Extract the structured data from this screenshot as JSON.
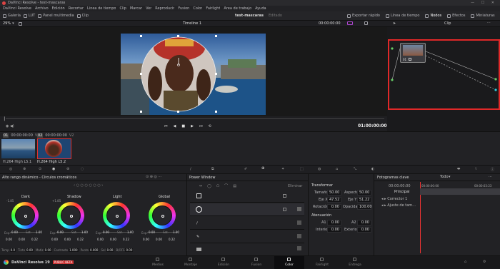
{
  "app": {
    "title": "DaVinci Resolve - test-mascaras",
    "menu": [
      "DaVinci Resolve",
      "Archivo",
      "Edición",
      "Recortar",
      "Línea de tiempo",
      "Clip",
      "Marcar",
      "Ver",
      "Reproducir",
      "Fusion",
      "Color",
      "Fairlight",
      "Área de trabajo",
      "Ayuda"
    ]
  },
  "toolbar": {
    "left": [
      "Galería",
      "LUT",
      "Panel multimedia",
      "Clip"
    ],
    "project": "test-mascaras",
    "edited": "Editado",
    "right": [
      "Exportar rápido",
      "Línea de tiempo",
      "Nodos",
      "Efectos",
      "Miniaturas"
    ]
  },
  "viewer": {
    "zoom": "29%",
    "timeline": "Timeline 1",
    "tc_in": "00:00:00:00",
    "tc_out": "01:00:00:00",
    "clip_label": "Clip"
  },
  "clips": [
    {
      "num": "01",
      "tc": "00:00:00:00",
      "track": "V1",
      "codec": "H.264 High L5.1"
    },
    {
      "num": "02",
      "tc": "00:00:00:00",
      "track": "V2",
      "codec": "H.264 High L5.2"
    }
  ],
  "node": {
    "id": "01"
  },
  "color_panel": {
    "title": "Alto rango dinámico - Círculos cromáticos",
    "wheels": [
      {
        "name": "Dark",
        "val": "-1.85",
        "exp": "0.00",
        "sat": "1.00",
        "x": "0.00",
        "y": "0.00",
        "z": "0.22"
      },
      {
        "name": "Shadow",
        "val": "+1.85",
        "exp": "0.00",
        "sat": "1.00",
        "x": "0.00",
        "y": "0.00",
        "z": "0.22"
      },
      {
        "name": "Light",
        "val": "",
        "exp": "0.00",
        "sat": "1.00",
        "x": "0.00",
        "y": "0.00",
        "z": "0.22"
      },
      {
        "name": "Global",
        "val": "",
        "exp": "0.00",
        "sat": "1.00",
        "x": "0.00",
        "y": "0.00",
        "z": "0.22"
      }
    ],
    "footer": [
      {
        "k": "Temp",
        "v": "0.0"
      },
      {
        "k": "Tinte",
        "v": "0.00"
      },
      {
        "k": "Matiz",
        "v": "0.00"
      },
      {
        "k": "Contraste",
        "v": "1.000"
      },
      {
        "k": "Punto",
        "v": "0.000"
      },
      {
        "k": "Sal",
        "v": "0.00"
      },
      {
        "k": "B/OFS",
        "v": "0.00"
      }
    ],
    "labels": {
      "exp": "Exp.",
      "sat": "Sat."
    }
  },
  "power_window": {
    "title": "Power Window",
    "delete": "Eliminar"
  },
  "transform": {
    "title": "Transformar",
    "size_label": "Tamaño",
    "size": "50.00",
    "aspect_label": "Aspecto",
    "aspect": "50.00",
    "pan_label": "Eje X",
    "pan": "47.52",
    "tilt_label": "Eje Y",
    "tilt": "51.22",
    "rot_label": "Rotación",
    "rot": "0.00",
    "opacity_label": "Opacidad",
    "opacity": "100.00",
    "soft_title": "Atenuación",
    "soft": [
      {
        "k": "A1",
        "v": "0.00"
      },
      {
        "k": "A2",
        "v": "0.00"
      },
      {
        "k": "Interior",
        "v": "0.00"
      },
      {
        "k": "Exterior",
        "v": "0.00"
      }
    ]
  },
  "keyframes": {
    "title": "Fotogramas clave",
    "filter": "Todo",
    "tc": "00:00:00:00",
    "tc2": "00:00:00:00",
    "tc3": "00:00:03:23",
    "tracks": [
      "Principal",
      "Corrector 1",
      "Ajuste de tam..."
    ]
  },
  "pages": [
    "Medios",
    "Montaje",
    "Edición",
    "Fusion",
    "Color",
    "Fairlight",
    "Entrega"
  ],
  "status": {
    "product": "DaVinci Resolve 19",
    "badge": "PUBLIC BETA"
  },
  "colors": {
    "accent": "#e64b4b",
    "selected": "#d33"
  }
}
